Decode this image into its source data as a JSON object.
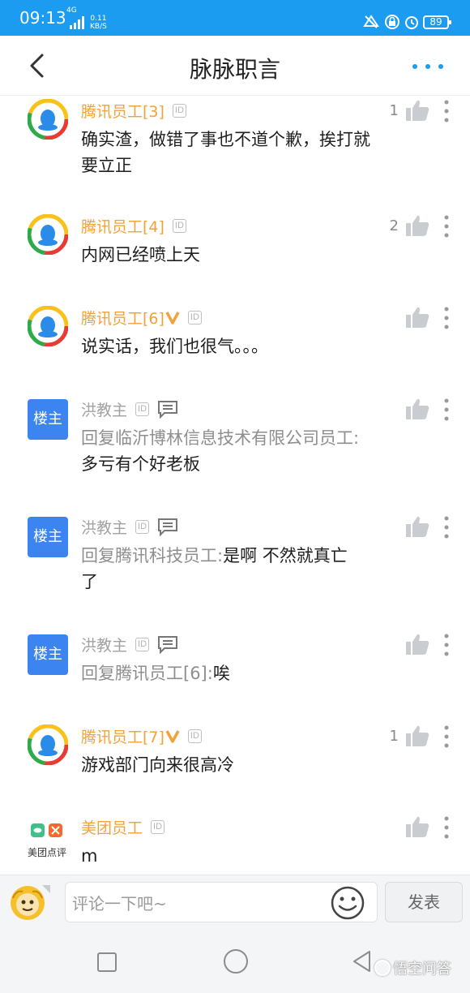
{
  "status_bar": {
    "time": "09:13",
    "network": "4G",
    "speed_value": "0.11",
    "speed_unit": "KB/S",
    "battery": "89"
  },
  "header": {
    "title": "脉脉职言"
  },
  "comments": [
    {
      "name": "腾讯员工[3]",
      "verified": false,
      "id_badge": "ID",
      "text": "确实渣，做错了事也不道个歉，挨打就要立正",
      "likes": "1"
    },
    {
      "name": "腾讯员工[4]",
      "verified": false,
      "id_badge": "ID",
      "text": "内网已经喷上天",
      "likes": "2"
    },
    {
      "name": "腾讯员工[6]",
      "verified": true,
      "id_badge": "ID",
      "text": "说实话，我们也很气。。。",
      "likes": ""
    },
    {
      "name": "洪教主",
      "avatar_label": "楼主",
      "id_badge": "ID",
      "reply_prefix": "回复临沂博林信息技术有限公司员工:",
      "text": "多亏有个好老板",
      "likes": ""
    },
    {
      "name": "洪教主",
      "avatar_label": "楼主",
      "id_badge": "ID",
      "reply_prefix": "回复腾讯科技员工:",
      "text": "是啊  不然就真亡了",
      "likes": ""
    },
    {
      "name": "洪教主",
      "avatar_label": "楼主",
      "id_badge": "ID",
      "reply_prefix": "回复腾讯员工[6]:",
      "text": "唉",
      "likes": ""
    },
    {
      "name": "腾讯员工[7]",
      "verified": true,
      "id_badge": "ID",
      "text": "游戏部门向来很高冷",
      "likes": "1"
    },
    {
      "name": "美团员工",
      "verified": false,
      "id_badge": "ID",
      "avatar_caption": "美团点评",
      "text": "m",
      "likes": ""
    }
  ],
  "input_bar": {
    "placeholder": "评论一下吧~",
    "send_label": "发表"
  },
  "watermark": "悟空问答",
  "colors": {
    "status_bar": "#1c9cf0",
    "accent_blue": "#1c9cf0",
    "name_orange": "#f2a23a",
    "landlord_badge": "#3c84f0"
  },
  "icons": [
    "back-arrow-icon",
    "more-dots-icon",
    "thumbs-up-icon",
    "kebab-menu-icon",
    "chat-bubble-icon",
    "verified-v-icon",
    "smiley-icon"
  ]
}
